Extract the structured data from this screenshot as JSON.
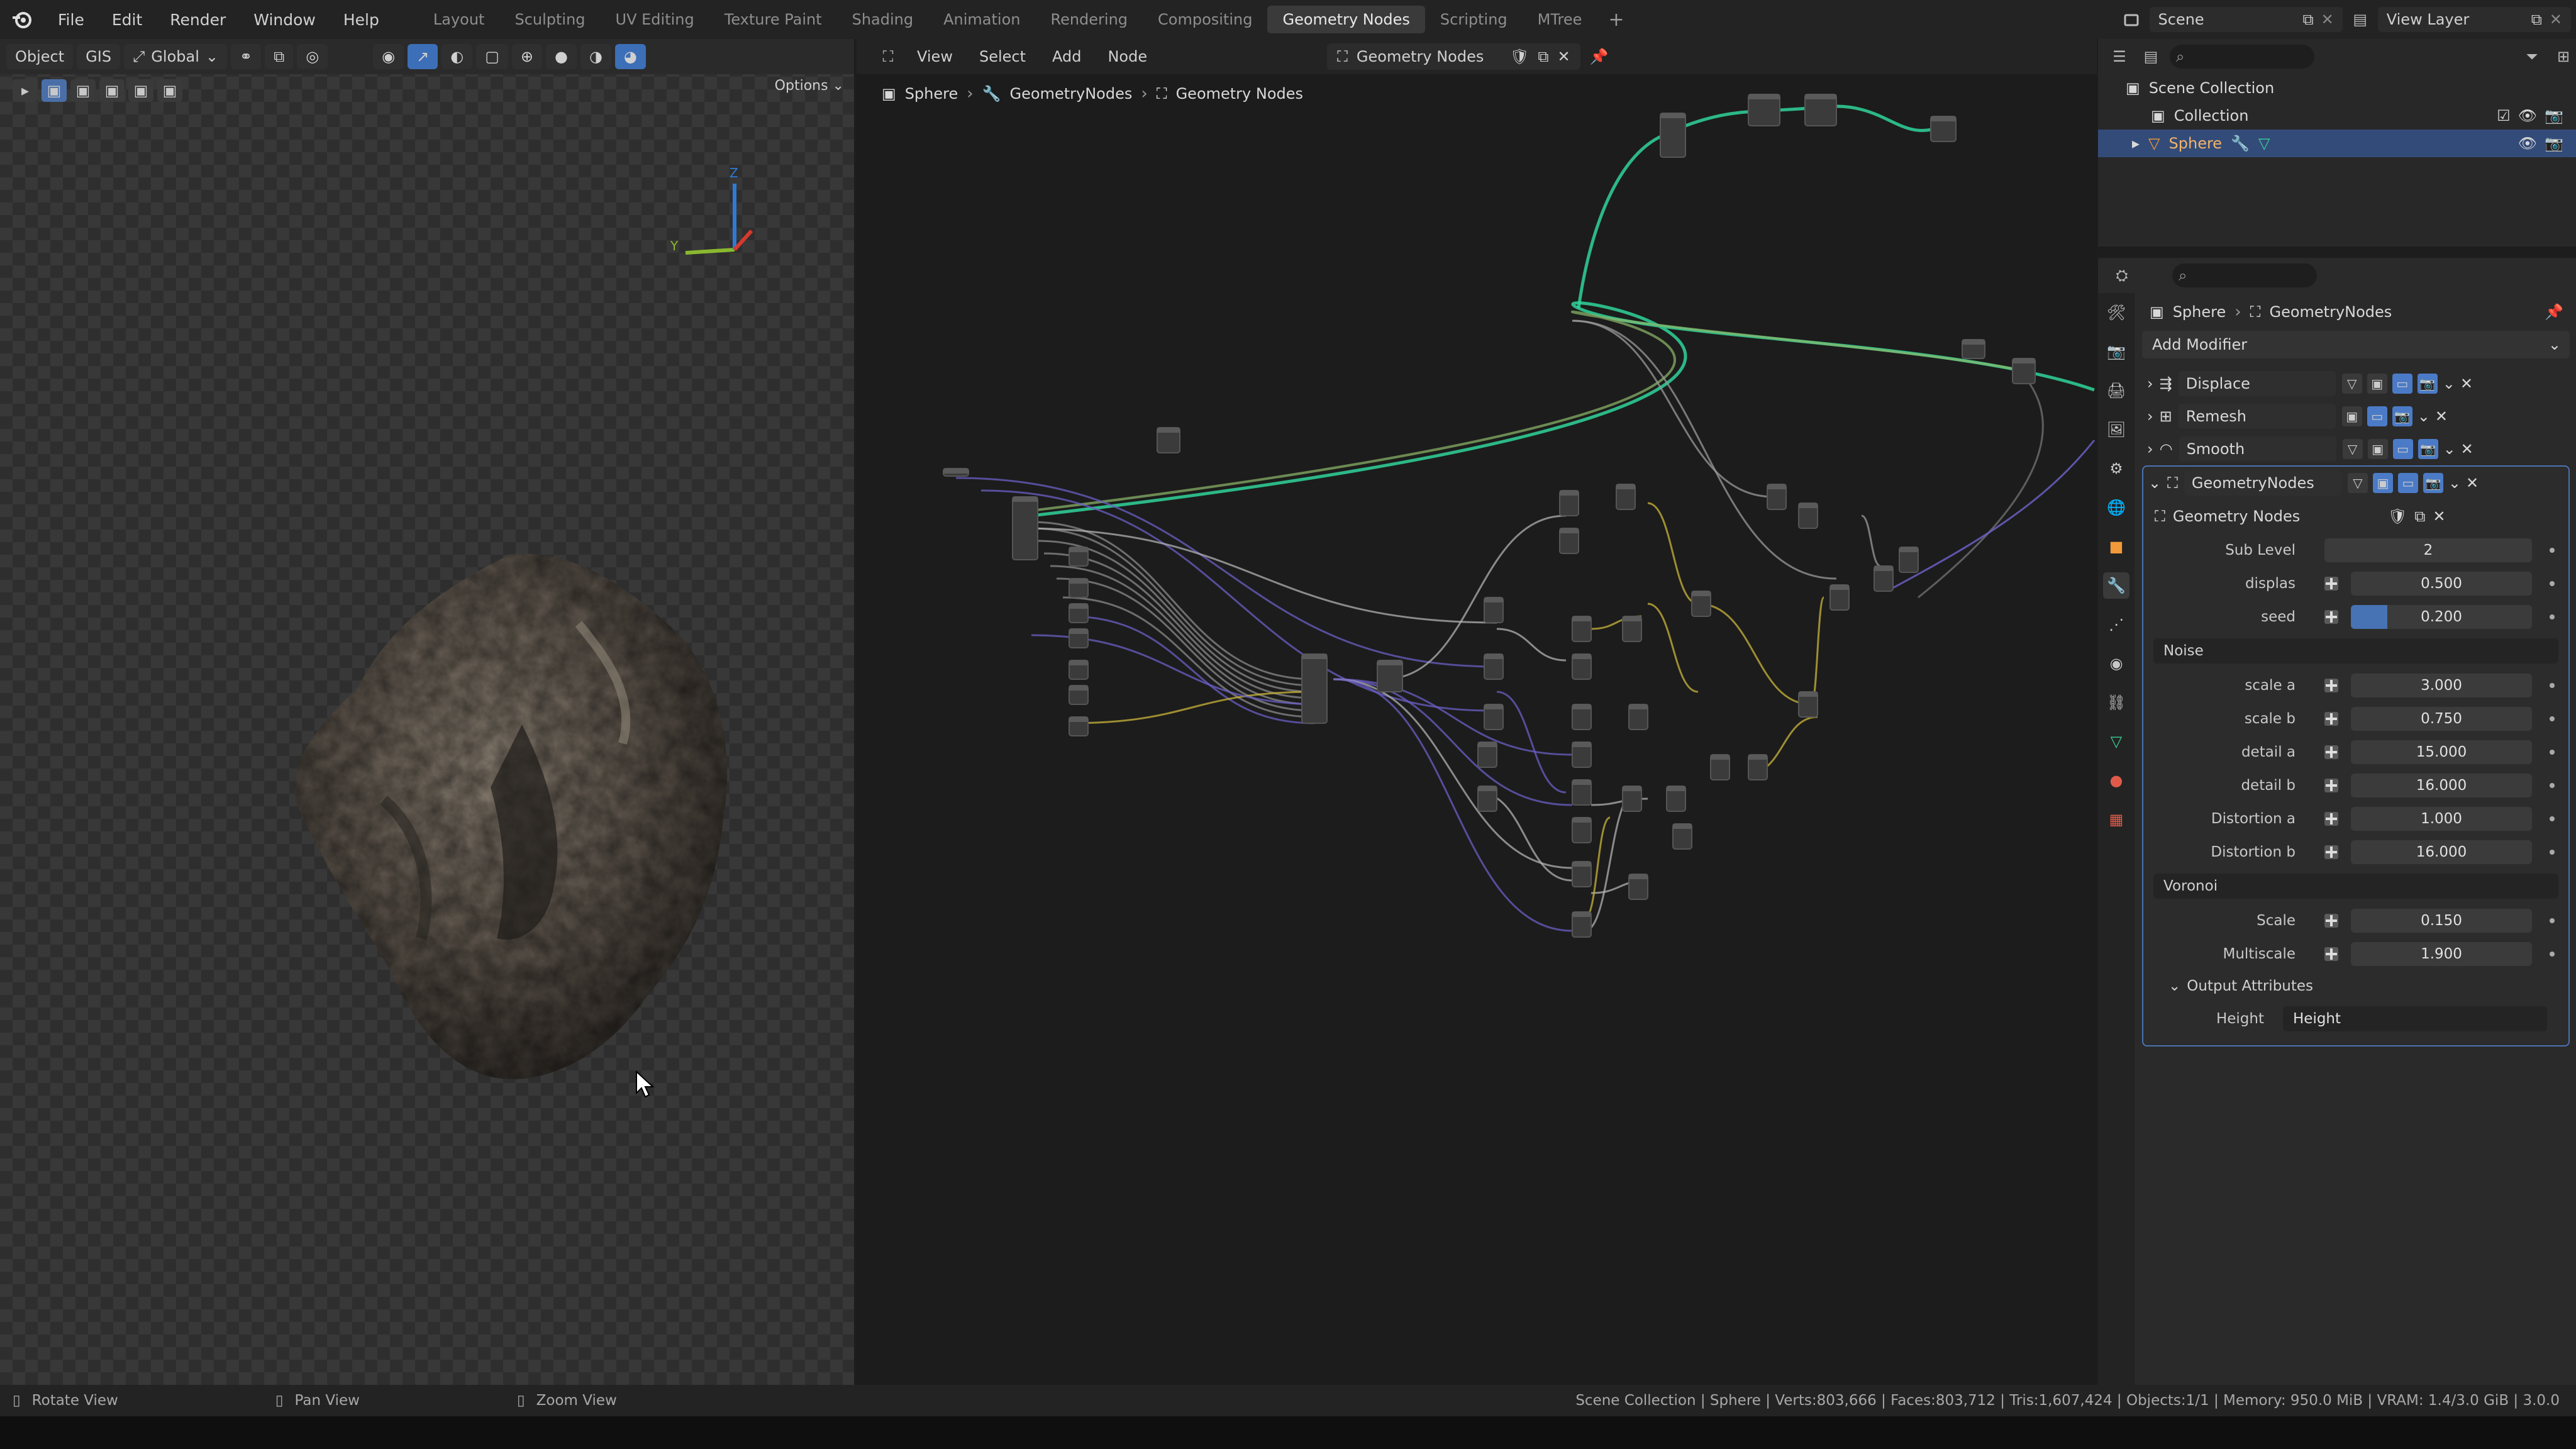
{
  "menubar": {
    "items": [
      "File",
      "Edit",
      "Render",
      "Window",
      "Help"
    ],
    "workspaces": [
      "Layout",
      "Sculpting",
      "UV Editing",
      "Texture Paint",
      "Shading",
      "Animation",
      "Rendering",
      "Compositing",
      "Geometry Nodes",
      "Scripting",
      "MTree"
    ],
    "active_workspace": "Geometry Nodes",
    "scene": "Scene",
    "view_layer": "View Layer"
  },
  "viewport": {
    "mode": "Object",
    "gis": "GIS",
    "orientation": "Global",
    "options": "Options"
  },
  "node_editor": {
    "menus": [
      "View",
      "Select",
      "Add",
      "Node"
    ],
    "node_tree": "Geometry Nodes",
    "breadcrumb": [
      "Sphere",
      "GeometryNodes",
      "Geometry Nodes"
    ]
  },
  "outliner": {
    "rows": [
      "Scene Collection",
      "Collection",
      "Sphere"
    ]
  },
  "properties": {
    "breadcrumb": [
      "Sphere",
      "GeometryNodes"
    ],
    "add_modifier": "Add Modifier",
    "modifiers": [
      "Displace",
      "Remesh",
      "Smooth",
      "GeometryNodes"
    ],
    "gn_tree": "Geometry Nodes",
    "inputs": [
      {
        "label": "Sub Level",
        "value": "2",
        "fill": 0
      },
      {
        "label": "displas",
        "value": "0.500",
        "fill": 0
      },
      {
        "label": "seed",
        "value": "0.200",
        "fill": 0.2
      }
    ],
    "noise_label": "Noise",
    "noise_inputs": [
      {
        "label": "scale a",
        "value": "3.000"
      },
      {
        "label": "scale b",
        "value": "0.750"
      },
      {
        "label": "detail a",
        "value": "15.000"
      },
      {
        "label": "detail b",
        "value": "16.000"
      },
      {
        "label": "Distortion a",
        "value": "1.000"
      },
      {
        "label": "Distortion b",
        "value": "16.000"
      }
    ],
    "voronoi_label": "Voronoi",
    "voronoi_inputs": [
      {
        "label": "Scale",
        "value": "0.150"
      },
      {
        "label": "Multiscale",
        "value": "1.900"
      }
    ],
    "output_attributes": "Output Attributes",
    "height_label": "Height",
    "height_value": "Height"
  },
  "statusbar": {
    "hints": [
      "Rotate View",
      "Pan View",
      "Zoom View"
    ],
    "info": "Scene Collection | Sphere | Verts:803,666 | Faces:803,712 | Tris:1,607,424 | Objects:1/1 | Memory: 950.0 MiB | VRAM: 1.4/3.0 GiB | 3.0.0"
  },
  "colors": {
    "accent": "#4772b3",
    "wire_green": "#2fd39a",
    "wire_purple": "#6a5fc4",
    "wire_yellow": "#c9b43a",
    "wire_gray": "#8a8a8a"
  }
}
